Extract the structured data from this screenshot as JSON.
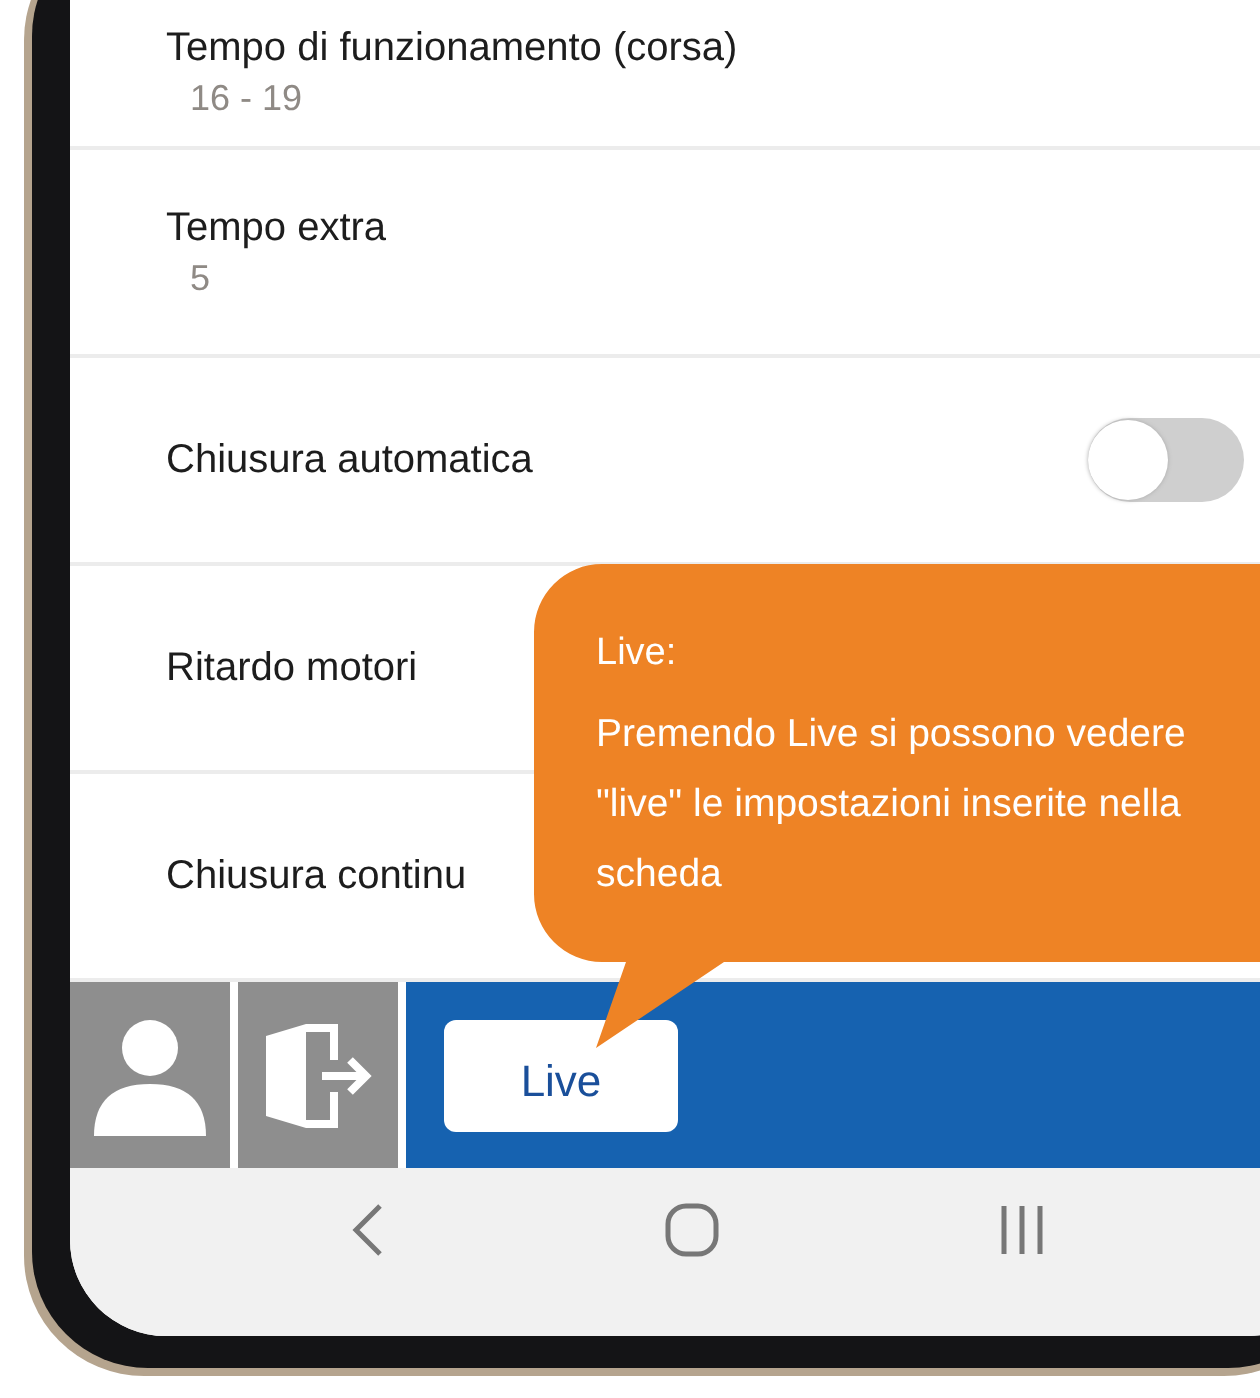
{
  "settings": [
    {
      "kind": "value",
      "label": "Tempo di funzionamento (corsa)",
      "value": "16 - 19"
    },
    {
      "kind": "value",
      "label": "Tempo extra",
      "value": "5"
    },
    {
      "kind": "toggle",
      "label": "Chiusura automatica",
      "on": false
    },
    {
      "kind": "plain",
      "label": "Ritardo motori"
    },
    {
      "kind": "plain",
      "label": "Chiusura continu"
    }
  ],
  "bottom_bar": {
    "live_button": "Live"
  },
  "callout": {
    "title": "Live:",
    "text": "Premendo Live si possono vedere \"live\" le impostazioni inserite nella scheda"
  }
}
